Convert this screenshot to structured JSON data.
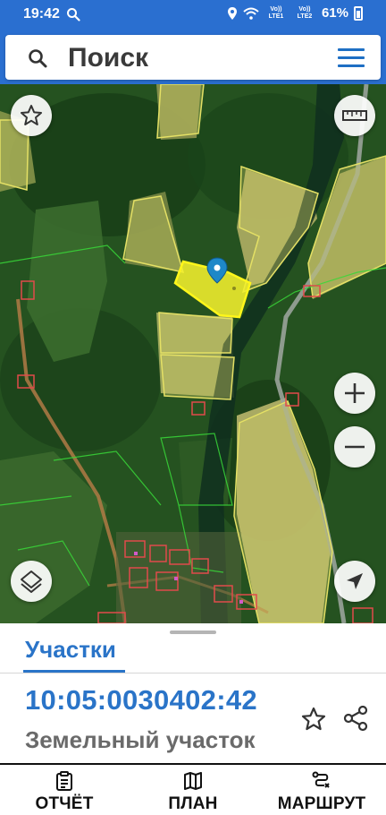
{
  "status_bar": {
    "time": "19:42",
    "network1": "Vo)) LTE1",
    "network2": "Vo)) LTE2",
    "battery": "61%"
  },
  "search": {
    "placeholder": "Поиск"
  },
  "map": {
    "selected_parcel_color": "#f3ef2c",
    "parcel_outline_color": "#e4e065",
    "boundary_color": "#38d838",
    "building_color": "#e14b4b",
    "marker_color": "#1e88c8"
  },
  "sheet": {
    "section_title": "Участки",
    "cadastral_number": "10:05:0030402:42",
    "parcel_type": "Земельный участок"
  },
  "bottom_nav": {
    "items": [
      {
        "label": "ОТЧЁТ",
        "icon": "report-icon"
      },
      {
        "label": "ПЛАН",
        "icon": "map-plan-icon"
      },
      {
        "label": "МАРШРУТ",
        "icon": "route-icon"
      }
    ]
  },
  "colors": {
    "accent": "#2a74c8",
    "header": "#2a6fd0"
  }
}
